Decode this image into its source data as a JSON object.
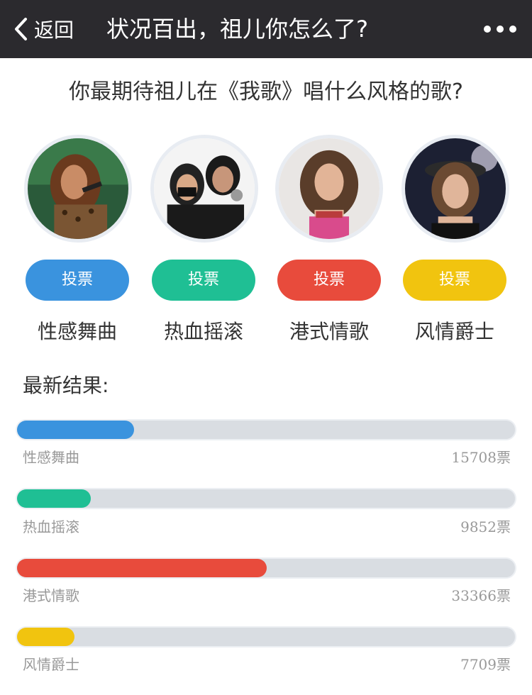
{
  "navbar": {
    "back_label": "返回",
    "title": "状况百出，祖儿你怎么了?"
  },
  "question": "你最期待祖儿在《我歌》唱什么风格的歌?",
  "options": [
    {
      "label": "性感舞曲",
      "vote_label": "投票",
      "color": "#3a93de"
    },
    {
      "label": "热血摇滚",
      "vote_label": "投票",
      "color": "#1fbf94"
    },
    {
      "label": "港式情歌",
      "vote_label": "投票",
      "color": "#e84b3c"
    },
    {
      "label": "风情爵士",
      "vote_label": "投票",
      "color": "#f1c40f"
    }
  ],
  "results": {
    "title": "最新结果:",
    "items": [
      {
        "name": "性感舞曲",
        "votes": 15708,
        "count_text": "15708票",
        "color": "#3a93de"
      },
      {
        "name": "热血摇滚",
        "votes": 9852,
        "count_text": "9852票",
        "color": "#1fbf94"
      },
      {
        "name": "港式情歌",
        "votes": 33366,
        "count_text": "33366票",
        "color": "#e84b3c"
      },
      {
        "name": "风情爵士",
        "votes": 7709,
        "count_text": "7709票",
        "color": "#f1c40f"
      }
    ]
  }
}
